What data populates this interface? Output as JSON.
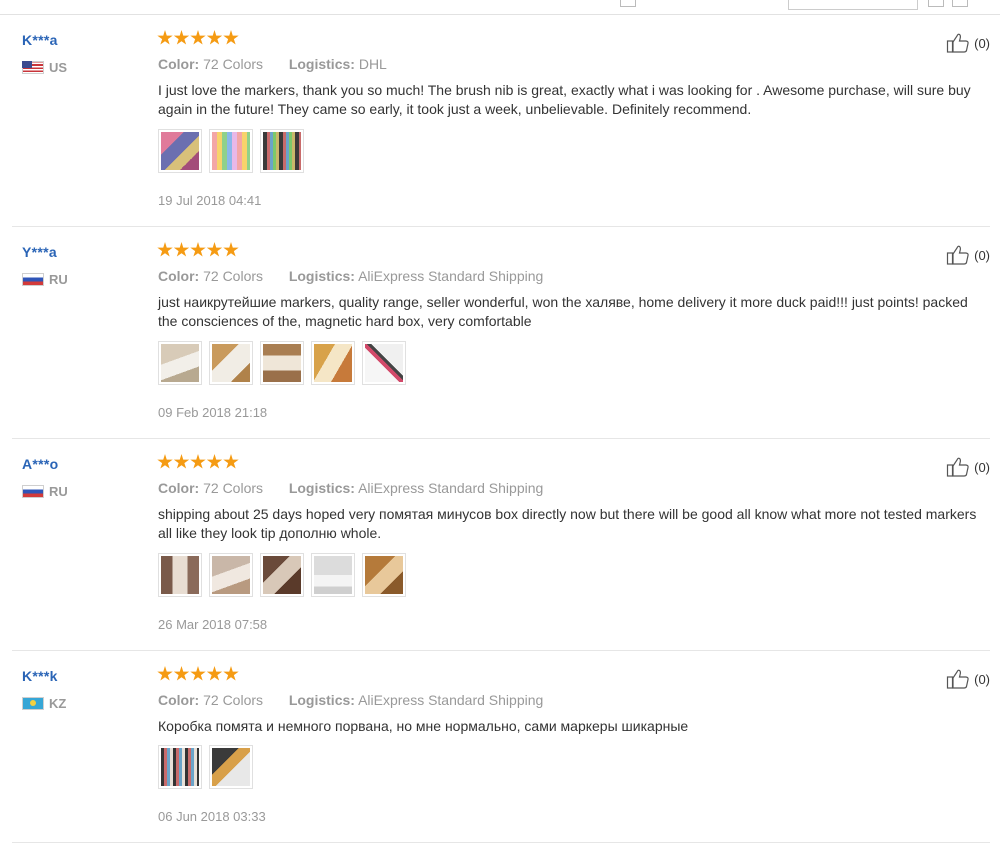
{
  "labels": {
    "color": "Color:",
    "logistics": "Logistics:"
  },
  "reviews": [
    {
      "user": "K***a",
      "country_code": "US",
      "rating": 5,
      "color": "72 Colors",
      "logistics": "DHL",
      "text": "I just love the markers, thank you so much! The brush nib is great, exactly what i was looking for . Awesome purchase, will sure buy again in the future! They came so early, it took just a week, unbelievable. Definitely recommend.",
      "images": 3,
      "date": "19 Jul 2018 04:41",
      "helpful": "(0)"
    },
    {
      "user": "Y***a",
      "country_code": "RU",
      "rating": 5,
      "color": "72 Colors",
      "logistics": "AliExpress Standard Shipping",
      "text": "just наикрутейшие markers, quality range, seller wonderful, won the халяве, home delivery it more duck paid!!! just points! packed the consciences of the, magnetic hard box, very comfortable",
      "images": 5,
      "date": "09 Feb 2018 21:18",
      "helpful": "(0)"
    },
    {
      "user": "A***o",
      "country_code": "RU",
      "rating": 5,
      "color": "72 Colors",
      "logistics": "AliExpress Standard Shipping",
      "text": "shipping about 25 days hoped very помятая минусов box directly now but there will be good all know what more not tested markers all like they look tip дополню whole.",
      "images": 5,
      "date": "26 Mar 2018 07:58",
      "helpful": "(0)"
    },
    {
      "user": "K***k",
      "country_code": "KZ",
      "rating": 5,
      "color": "72 Colors",
      "logistics": "AliExpress Standard Shipping",
      "text": "Коробка помята и немного порвана, но мне нормально, сами маркеры шикарные",
      "images": 2,
      "date": "06 Jun 2018 03:33",
      "helpful": "(0)"
    }
  ],
  "colors": {
    "username": "#2a64b6",
    "star": "#f59b13",
    "muted": "#999999"
  },
  "icons": {
    "helpful": "thumbs-up-icon"
  }
}
